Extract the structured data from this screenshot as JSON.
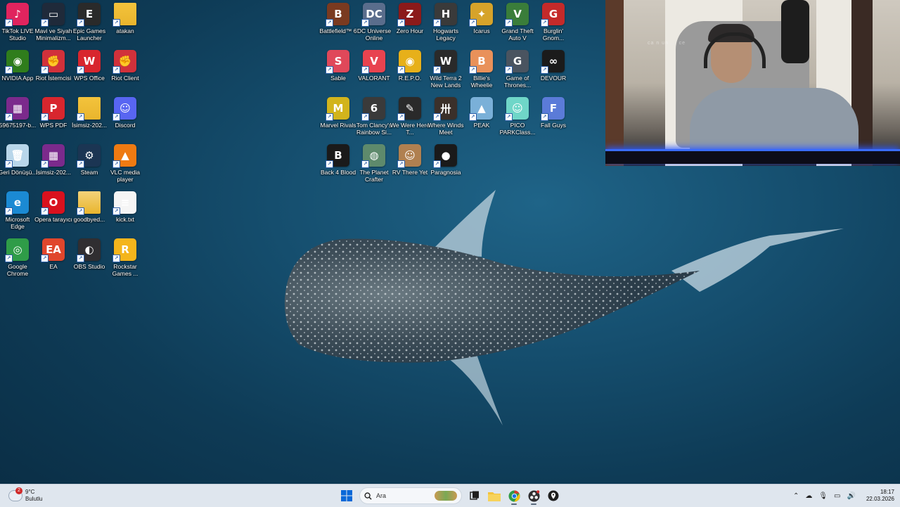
{
  "desktop": {
    "left_icons": [
      {
        "label": "TikTok LIVE Studio",
        "icon": "tiktok-icon",
        "color": "#e0245e",
        "glyph": "♪"
      },
      {
        "label": "Mavi ve Siyah Minimalizm...",
        "icon": "image-file-icon",
        "color": "#1f2a3a",
        "glyph": "▭"
      },
      {
        "label": "Epic Games Launcher",
        "icon": "epic-games-icon",
        "color": "#2a2a2a",
        "glyph": "E"
      },
      {
        "label": "atakan",
        "icon": "folder-icon",
        "color": "#f3c33c",
        "glyph": ""
      },
      {
        "label": "NVIDIA App",
        "icon": "nvidia-icon",
        "color": "#2f7d1c",
        "glyph": "◉"
      },
      {
        "label": "Riot İstemcisi",
        "icon": "riot-icon",
        "color": "#d1313b",
        "glyph": "✊"
      },
      {
        "label": "WPS Office",
        "icon": "wps-office-icon",
        "color": "#d8262e",
        "glyph": "W"
      },
      {
        "label": "Riot Client",
        "icon": "riot-icon",
        "color": "#d1313b",
        "glyph": "✊"
      },
      {
        "label": "59675197-b...",
        "icon": "archive-icon",
        "color": "#7b2a8c",
        "glyph": "▦"
      },
      {
        "label": "WPS PDF",
        "icon": "wps-pdf-icon",
        "color": "#d8262e",
        "glyph": "P"
      },
      {
        "label": "İsimsiz-202...",
        "icon": "folder-icon",
        "color": "#f3c33c",
        "glyph": ""
      },
      {
        "label": "Discord",
        "icon": "discord-icon",
        "color": "#5865f2",
        "glyph": "☺"
      },
      {
        "label": "Geri Dönüşü...",
        "icon": "recycle-bin-icon",
        "color": "#b8d6ea",
        "glyph": "🗑"
      },
      {
        "label": "İsimsiz-202...",
        "icon": "archive-icon",
        "color": "#7b2a8c",
        "glyph": "▦"
      },
      {
        "label": "Steam",
        "icon": "steam-icon",
        "color": "#1b3553",
        "glyph": "⚙"
      },
      {
        "label": "VLC media player",
        "icon": "vlc-icon",
        "color": "#ee7a12",
        "glyph": "▲"
      },
      {
        "label": "Microsoft Edge",
        "icon": "edge-icon",
        "color": "#1b8ad3",
        "glyph": "e"
      },
      {
        "label": "Opera tarayıcı",
        "icon": "opera-icon",
        "color": "#d9111e",
        "glyph": "O"
      },
      {
        "label": "goodbyed...",
        "icon": "folder-icon",
        "color": "#f3d37a",
        "glyph": ""
      },
      {
        "label": "kick.txt",
        "icon": "text-file-icon",
        "color": "#f5f5f5",
        "glyph": "≡"
      },
      {
        "label": "Google Chrome",
        "icon": "chrome-icon",
        "color": "#2f9c48",
        "glyph": "◎"
      },
      {
        "label": "EA",
        "icon": "ea-icon",
        "color": "#e0462c",
        "glyph": "EA"
      },
      {
        "label": "OBS Studio",
        "icon": "obs-icon",
        "color": "#302e31",
        "glyph": "◐"
      },
      {
        "label": "Rockstar Games ...",
        "icon": "rockstar-icon",
        "color": "#f4b51c",
        "glyph": "R"
      }
    ],
    "right_icons": [
      {
        "label": "Battlefield™ 6",
        "icon": "battlefield-icon",
        "color": "#7a3a20",
        "glyph": "B"
      },
      {
        "label": "DC Universe Online",
        "icon": "dc-universe-icon",
        "color": "#5a6d8c",
        "glyph": "DC"
      },
      {
        "label": "Zero Hour",
        "icon": "zero-hour-icon",
        "color": "#8b1a1a",
        "glyph": "Z"
      },
      {
        "label": "Hogwarts Legacy",
        "icon": "hogwarts-icon",
        "color": "#3a3a3a",
        "glyph": "H"
      },
      {
        "label": "Icarus",
        "icon": "icarus-icon",
        "color": "#d6a32a",
        "glyph": "✦"
      },
      {
        "label": "Grand Theft Auto V",
        "icon": "gta-icon",
        "color": "#3a7d3a",
        "glyph": "V"
      },
      {
        "label": "Burglin' Gnom...",
        "icon": "burglin-gnomes-icon",
        "color": "#c42a2a",
        "glyph": "G"
      },
      {
        "label": "Sable",
        "icon": "sable-icon",
        "color": "#e0485a",
        "glyph": "S"
      },
      {
        "label": "VALORANT",
        "icon": "valorant-icon",
        "color": "#e8434f",
        "glyph": "V"
      },
      {
        "label": "R.E.P.O.",
        "icon": "repo-icon",
        "color": "#e7b01a",
        "glyph": "◉"
      },
      {
        "label": "Wild Terra 2 New Lands",
        "icon": "wild-terra-icon",
        "color": "#2a2a2a",
        "glyph": "W"
      },
      {
        "label": "Billie's Wheelie",
        "icon": "billies-wheelie-icon",
        "color": "#e9915a",
        "glyph": "B"
      },
      {
        "label": "Game of Thrones...",
        "icon": "game-of-thrones-icon",
        "color": "#4a5460",
        "glyph": "G"
      },
      {
        "label": "DEVOUR",
        "icon": "devour-icon",
        "color": "#1b1b1b",
        "glyph": "∞"
      },
      {
        "label": "Marvel Rivals",
        "icon": "marvel-rivals-icon",
        "color": "#d2b41c",
        "glyph": "M"
      },
      {
        "label": "Tom Clancy's Rainbow Si...",
        "icon": "rainbow-six-icon",
        "color": "#3a3a3a",
        "glyph": "6"
      },
      {
        "label": "We Were Here T...",
        "icon": "we-were-here-icon",
        "color": "#2a2a2a",
        "glyph": "✎"
      },
      {
        "label": "Where Winds Meet",
        "icon": "where-winds-meet-icon",
        "color": "#3b302a",
        "glyph": "卅"
      },
      {
        "label": "PEAK",
        "icon": "peak-icon",
        "color": "#7ab0d8",
        "glyph": "▲"
      },
      {
        "label": "PICO PARKClass...",
        "icon": "pico-park-icon",
        "color": "#6fd6c8",
        "glyph": "☺"
      },
      {
        "label": "Fall Guys",
        "icon": "fall-guys-icon",
        "color": "#5b7bd8",
        "glyph": "F"
      },
      {
        "label": "Back 4 Blood",
        "icon": "back-4-blood-icon",
        "color": "#1a1a1a",
        "glyph": "B"
      },
      {
        "label": "The Planet Crafter",
        "icon": "planet-crafter-icon",
        "color": "#5e8a6c",
        "glyph": "◍"
      },
      {
        "label": "RV There Yet",
        "icon": "rv-there-yet-icon",
        "color": "#b08050",
        "glyph": "☺"
      },
      {
        "label": "Paragnosia",
        "icon": "paragnosia-icon",
        "color": "#1a1a1a",
        "glyph": "●"
      }
    ]
  },
  "webcam": {
    "watermark": "ca n un ... ce"
  },
  "taskbar": {
    "weather": {
      "badge": "2",
      "temp": "9°C",
      "condition": "Bulutlu"
    },
    "search_placeholder": "Ara",
    "pinned": [
      {
        "icon": "windows-start-icon",
        "color": "#0a68d8"
      },
      {
        "icon": "task-view-icon",
        "color": "#1e1e1e"
      },
      {
        "icon": "file-explorer-icon",
        "color": "#f3c33c"
      },
      {
        "icon": "chrome-icon",
        "color": "#2f9c48"
      },
      {
        "icon": "obs-icon",
        "color": "#302e31"
      },
      {
        "icon": "location-icon",
        "color": "#1e1e1e"
      }
    ],
    "tray_icons": [
      "chevron-up-icon",
      "onedrive-icon",
      "microphone-icon",
      "display-icon",
      "volume-icon"
    ],
    "clock": {
      "time": "18:17",
      "date": "22.03.2026"
    }
  }
}
